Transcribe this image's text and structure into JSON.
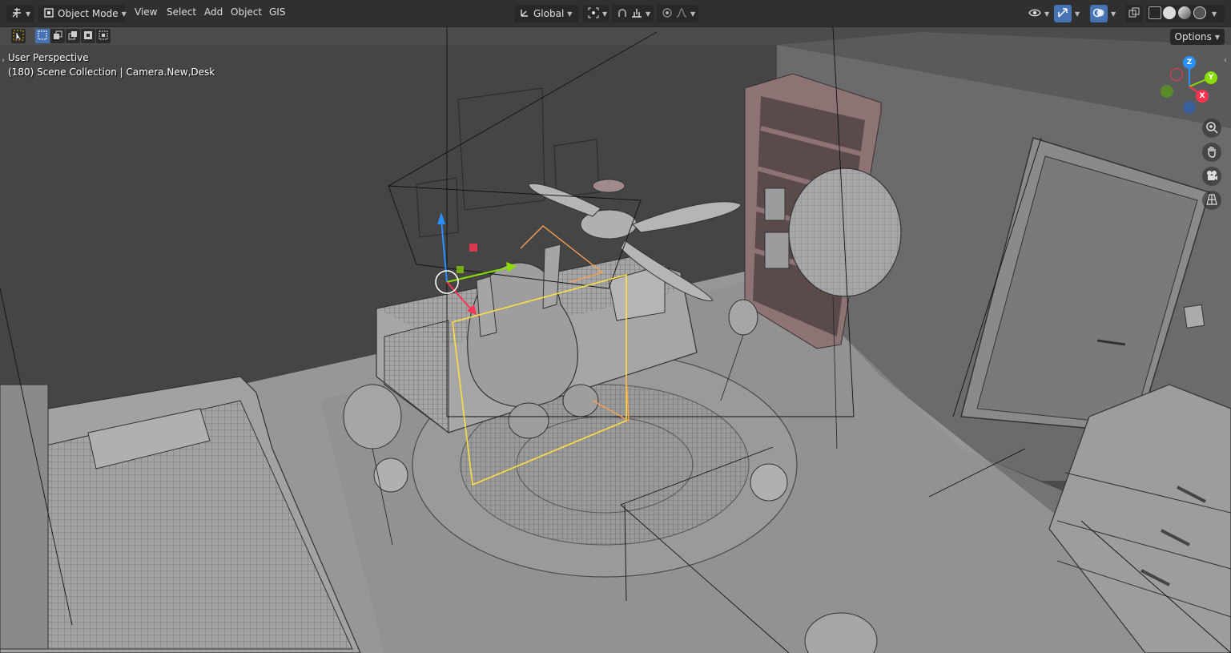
{
  "header": {
    "mode_label": "Object Mode",
    "menus": [
      "View",
      "Select",
      "Add",
      "Object",
      "GIS"
    ],
    "transform_orientation": "Global"
  },
  "viewport": {
    "view_name": "User Perspective",
    "scene_info": "(180) Scene Collection | Camera.New,Desk",
    "options_label": "Options",
    "gizmo_axes": {
      "z": "Z",
      "y": "Y",
      "x": "X"
    }
  },
  "colors": {
    "accent": "#4772b3",
    "axis_x": "#ff3352",
    "axis_y": "#8bdc00",
    "axis_z": "#2890ff",
    "selection": "#ffa14d",
    "active": "#ffdf40"
  },
  "icons": {
    "editor_type": "editor-type-icon",
    "mode": "object-mode-icon",
    "pivot": "pivot-point-icon",
    "snap": "snap-magnet-icon",
    "proportional": "proportional-edit-icon",
    "visibility": "eye-icon",
    "gizmo": "gizmo-arrows-icon",
    "overlays": "overlays-icon",
    "xray": "xray-icon",
    "zoom": "zoom-icon",
    "pan": "hand-icon",
    "camera": "camera-icon",
    "ortho": "grid-icon"
  }
}
